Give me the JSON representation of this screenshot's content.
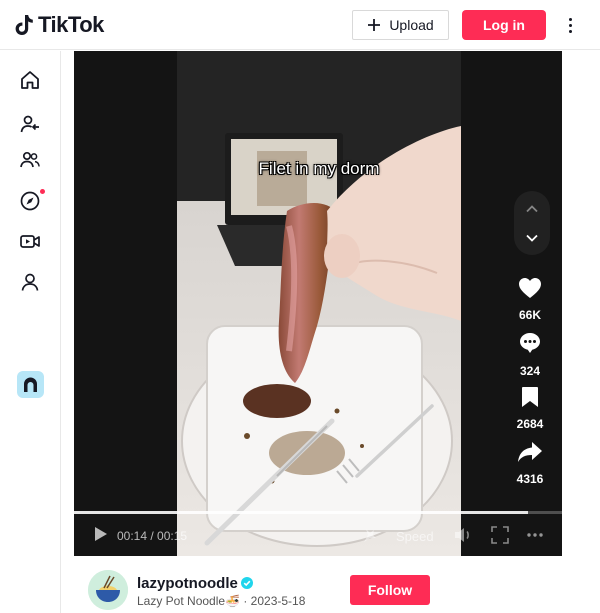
{
  "header": {
    "logo_text": "TikTok",
    "upload_label": "Upload",
    "login_label": "Log in"
  },
  "sidebar": {
    "items": [
      {
        "name": "home-icon"
      },
      {
        "name": "following-icon"
      },
      {
        "name": "friends-icon"
      },
      {
        "name": "explore-icon"
      },
      {
        "name": "live-icon"
      },
      {
        "name": "profile-icon"
      }
    ]
  },
  "video": {
    "caption": "Filet in my dorm",
    "likes": "66K",
    "comments": "324",
    "saves": "2684",
    "shares": "4316",
    "time": "00:14 / 00:15",
    "progress": 0.93,
    "speed_label": "Speed"
  },
  "author": {
    "username": "lazypotnoodle",
    "display_name": "Lazy Pot Noodle🍜",
    "date": "2023-5-18",
    "follow_label": "Follow"
  },
  "colors": {
    "brand": "#fe2c55",
    "verified": "#20d5ec"
  }
}
